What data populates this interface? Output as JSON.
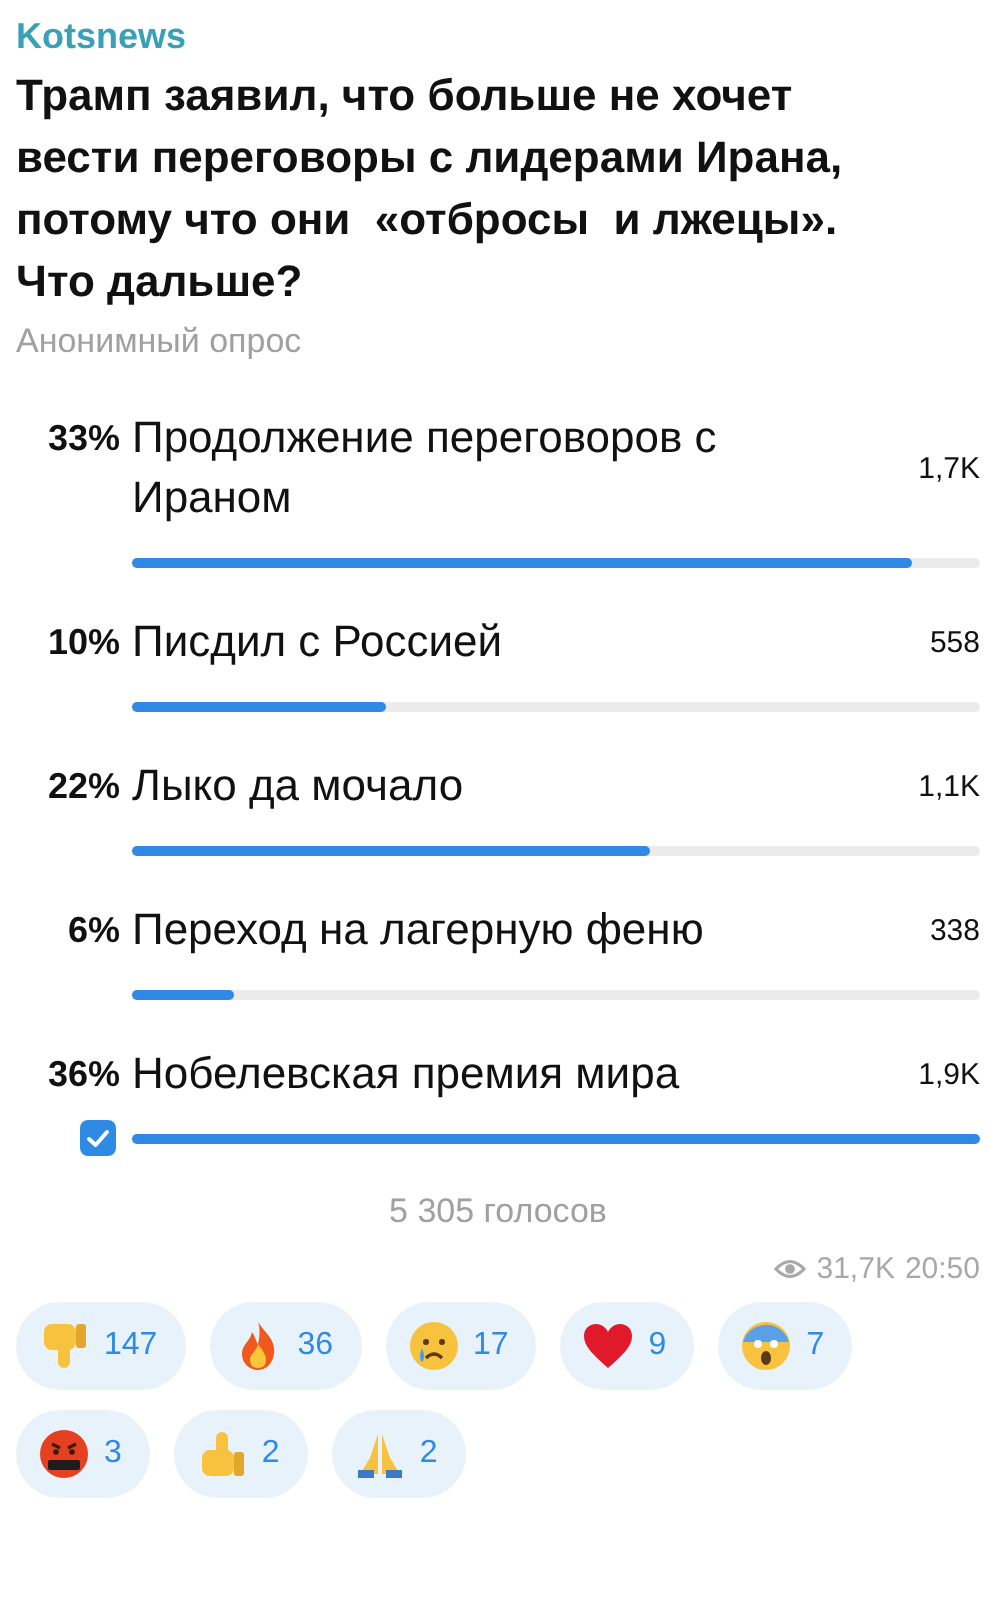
{
  "channel": "Kotsnews",
  "question": "Трамп заявил, что больше не хочет вести переговоры с лидерами Ирана, потому что они  «отбросы  и лжецы». Что дальше?",
  "poll_type": "Анонимный опрос",
  "options": [
    {
      "percent": "33%",
      "text": "Продолжение переговоров с Ираном",
      "count": "1,7K",
      "level": 0.92,
      "selected": false
    },
    {
      "percent": "10%",
      "text": "Писдил с Россией",
      "count": "558",
      "level": 0.3,
      "selected": false
    },
    {
      "percent": "22%",
      "text": "Лыко да мочало",
      "count": "1,1K",
      "level": 0.61,
      "selected": false
    },
    {
      "percent": "6%",
      "text": "Переход на лагерную феню",
      "count": "338",
      "level": 0.12,
      "selected": false
    },
    {
      "percent": "36%",
      "text": "Нобелевская премия мира",
      "count": "1,9K",
      "level": 1,
      "selected": true
    }
  ],
  "votes": "5 305 голосов",
  "views": "31,7K",
  "time": "20:50",
  "reactions": [
    {
      "kind": "thumbs-down",
      "count": "147"
    },
    {
      "kind": "fire",
      "count": "36"
    },
    {
      "kind": "crying",
      "count": "17"
    },
    {
      "kind": "heart",
      "count": "9"
    },
    {
      "kind": "scream",
      "count": "7"
    },
    {
      "kind": "cursing",
      "count": "3"
    },
    {
      "kind": "thumbs-up",
      "count": "2"
    },
    {
      "kind": "pray",
      "count": "2"
    }
  ]
}
